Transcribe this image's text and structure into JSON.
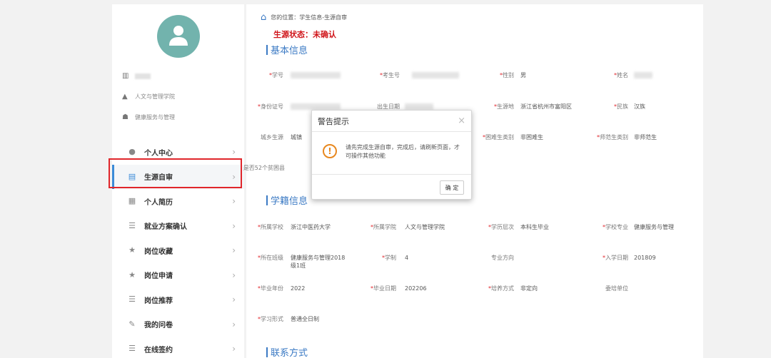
{
  "sidebar": {
    "info": [
      {
        "icon": "building-icon",
        "text": ""
      },
      {
        "icon": "graduation-cap-icon",
        "text": "人文与管理学院"
      },
      {
        "icon": "group-icon",
        "text": "健康服务与管理"
      }
    ],
    "menu": [
      {
        "name": "menu-personal-center",
        "icon": "user-icon",
        "label": "个人中心",
        "active": false
      },
      {
        "name": "menu-source-review",
        "icon": "id-card-icon",
        "label": "生源自审",
        "active": true
      },
      {
        "name": "menu-resume",
        "icon": "document-icon",
        "label": "个人简历",
        "active": false
      },
      {
        "name": "menu-employment-plan",
        "icon": "list-icon",
        "label": "就业方案确认",
        "active": false
      },
      {
        "name": "menu-job-favorites",
        "icon": "star-icon",
        "label": "岗位收藏",
        "active": false
      },
      {
        "name": "menu-job-applications",
        "icon": "star-icon",
        "label": "岗位申请",
        "active": false
      },
      {
        "name": "menu-job-recommend",
        "icon": "list-icon",
        "label": "岗位推荐",
        "active": false
      },
      {
        "name": "menu-my-survey",
        "icon": "edit-icon",
        "label": "我的问卷",
        "active": false
      },
      {
        "name": "menu-online-sign",
        "icon": "list-icon",
        "label": "在线签约",
        "active": false
      }
    ],
    "arrow": "›"
  },
  "breadcrumb": "您的位置：学生信息-生源自审",
  "status": "生源状态：未确认",
  "sections": {
    "basic": "基本信息",
    "school": "学籍信息",
    "contact": "联系方式"
  },
  "basic_fields": {
    "student_id": {
      "label": "学号",
      "value": ""
    },
    "exam_id": {
      "label": "考生号",
      "value": ""
    },
    "gender": {
      "label": "性别",
      "value": "男"
    },
    "name": {
      "label": "姓名",
      "value": ""
    },
    "id_number": {
      "label": "身份证号",
      "value": ""
    },
    "birth": {
      "label": "出生日期",
      "value": ""
    },
    "origin": {
      "label": "生源地",
      "value": "浙江省杭州市富阳区"
    },
    "ethnicity": {
      "label": "民族",
      "value": "汉族"
    },
    "urban_rural": {
      "label": "城乡生源",
      "value": "城镇"
    },
    "hardship": {
      "label": "困难生类别",
      "value": "非困难生"
    },
    "normal_student": {
      "label": "师范生类别",
      "value": "非师范生"
    },
    "poor_county": {
      "label": "是否52个贫困县",
      "value": ""
    }
  },
  "school_fields": {
    "school": {
      "label": "所属学校",
      "value": "浙江中医药大学"
    },
    "college": {
      "label": "所属学院",
      "value": "人文与管理学院"
    },
    "level": {
      "label": "学历层次",
      "value": "本科生毕业"
    },
    "major": {
      "label": "学校专业",
      "value": "健康服务与管理"
    },
    "class": {
      "label": "所在班级",
      "value": "健康服务与管理2018级1班"
    },
    "years": {
      "label": "学制",
      "value": "4"
    },
    "direction": {
      "label": "专业方向",
      "value": ""
    },
    "enroll_date": {
      "label": "入学日期",
      "value": "201809"
    },
    "grad_year": {
      "label": "毕业年份",
      "value": "2022"
    },
    "grad_date": {
      "label": "毕业日期",
      "value": "202206"
    },
    "training": {
      "label": "培养方式",
      "value": "非定向"
    },
    "commission": {
      "label": "委培单位",
      "value": ""
    },
    "study_form": {
      "label": "学习形式",
      "value": "普通全日制"
    }
  },
  "modal": {
    "title": "警告提示",
    "close": "×",
    "message": "请先完成生源自审，完成后，请刷新页面，才可操作其他功能",
    "ok": "确 定",
    "icon": "!"
  },
  "colors": {
    "accent": "#3b7ac4",
    "avatar": "#72b3ad",
    "highlight_border": "#e0262b",
    "status_text": "#d0161b",
    "warning": "#e8881f"
  }
}
